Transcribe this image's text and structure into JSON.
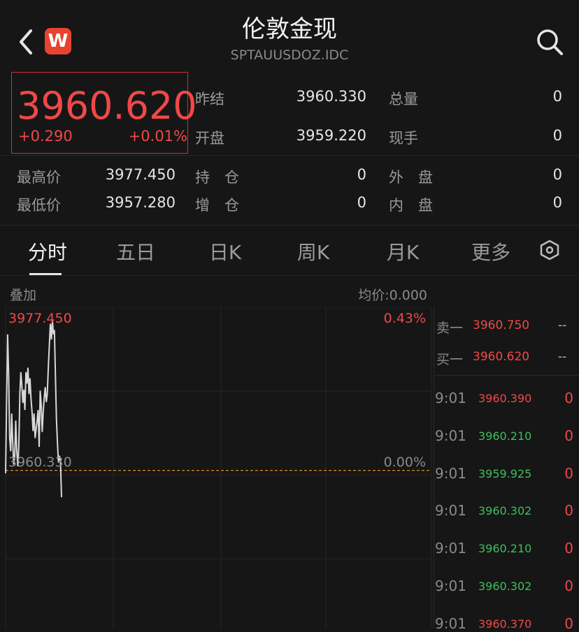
{
  "header": {
    "title": "伦敦金现",
    "subtitle": "SPTAUUSDOZ.IDC",
    "logo_text": "W"
  },
  "quote": {
    "last_price": "3960.620",
    "change": "+0.290",
    "change_pct": "+0.01%",
    "stats_top": [
      {
        "label": "昨结",
        "value": "3960.330",
        "label2": "总量",
        "value2": "0"
      },
      {
        "label": "开盘",
        "value": "3959.220",
        "label2": "现手",
        "value2": "0"
      }
    ],
    "stats_bottom": [
      {
        "label": "最高价",
        "value": "3977.450",
        "label2": "持　仓",
        "value2": "0",
        "label3": "外　盘",
        "value3": "0"
      },
      {
        "label": "最低价",
        "value": "3957.280",
        "label2": "增　仓",
        "value2": "0",
        "label3": "内　盘",
        "value3": "0"
      }
    ]
  },
  "tabs": [
    "分时",
    "五日",
    "日K",
    "周K",
    "月K",
    "更多"
  ],
  "active_tab": "分时",
  "chart_header": {
    "overlay_label": "叠加",
    "avg_price_label": "均价:0.000"
  },
  "chart_data": {
    "type": "line",
    "y_top_label": "3977.450",
    "y_top_pct": "0.43%",
    "y_mid_label": "3960.330",
    "y_mid_pct": "0.00%",
    "ylim": [
      3957.28,
      3977.45
    ],
    "reference": 3960.33,
    "values": [
      3960.0,
      3968.5,
      3975.8,
      3971.0,
      3964.0,
      3962.5,
      3966.8,
      3963.5,
      3961.0,
      3962.0,
      3966.0,
      3962.5,
      3960.8,
      3963.0,
      3969.0,
      3971.5,
      3970.0,
      3968.0,
      3969.5,
      3967.2,
      3971.5,
      3970.2,
      3972.0,
      3969.0,
      3970.8,
      3968.4,
      3967.0,
      3964.8,
      3966.8,
      3964.0,
      3965.0,
      3966.0,
      3967.2,
      3963.0,
      3969.4,
      3967.8,
      3964.7,
      3967.0,
      3968.6,
      3969.8,
      3968.1,
      3969.0,
      3972.0,
      3974.5,
      3977.0,
      3975.2,
      3977.45,
      3975.8,
      3976.3,
      3971.0,
      3966.2,
      3963.4,
      3961.2,
      3962.0,
      3961.3,
      3957.28
    ],
    "colors": {
      "line": "#d8d8d8",
      "reference": "#e08a2a"
    }
  },
  "order_book": {
    "sell": {
      "label": "卖一",
      "price": "3960.750",
      "qty": "--"
    },
    "buy": {
      "label": "买一",
      "price": "3960.620",
      "qty": "--"
    }
  },
  "ticks": [
    {
      "time": "9:01",
      "price": "3960.390",
      "dir": "up",
      "vol": "0"
    },
    {
      "time": "9:01",
      "price": "3960.210",
      "dir": "down",
      "vol": "0"
    },
    {
      "time": "9:01",
      "price": "3959.925",
      "dir": "down",
      "vol": "0"
    },
    {
      "time": "9:01",
      "price": "3960.302",
      "dir": "down",
      "vol": "0"
    },
    {
      "time": "9:01",
      "price": "3960.210",
      "dir": "down",
      "vol": "0"
    },
    {
      "time": "9:01",
      "price": "3960.302",
      "dir": "down",
      "vol": "0"
    },
    {
      "time": "9:01",
      "price": "3960.370",
      "dir": "up",
      "vol": "0"
    }
  ]
}
